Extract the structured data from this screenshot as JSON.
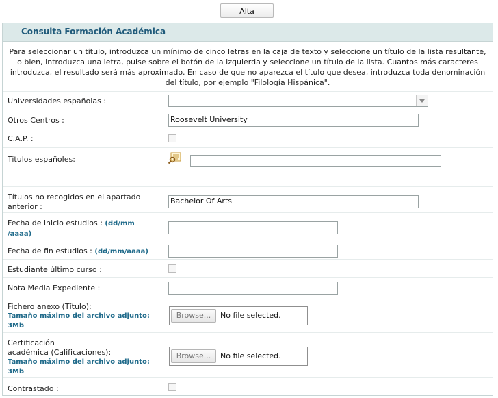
{
  "toolbar": {
    "alta_label": "Alta"
  },
  "panel": {
    "title": "Consulta Formación Académica",
    "intro": "Para seleccionar un título, introduzca un mínimo de cinco letras en la caja de texto y seleccione un título de la lista resultante, o bien, introduzca una letra, pulse sobre el botón de la izquierda y seleccione un título de la lista. Cuantos más caracteres introduzca, el resultado será más aproximado. En caso de que no aparezca el título que desea, introduzca toda denominación del título, por ejemplo \"Filología Hispánica\"."
  },
  "form": {
    "universidades": {
      "label": "Universidades españolas :",
      "value": ""
    },
    "otros_centros": {
      "label": "Otros Centros :",
      "value": "Roosevelt University"
    },
    "cap": {
      "label": "C.A.P. :",
      "checked": false
    },
    "titulos_espanoles": {
      "label": "Titulos españoles:",
      "value": ""
    },
    "titulos_no_recogidos": {
      "label_line1": "Títulos no recogidos en el apartado",
      "label_line2": "anterior :",
      "value": "Bachelor Of Arts"
    },
    "fecha_inicio": {
      "label": "Fecha de inicio estudios :",
      "hint": "(dd/mm",
      "hint2": "/aaaa)",
      "value": ""
    },
    "fecha_fin": {
      "label": "Fecha de fin estudios :",
      "hint": "(dd/mm/aaaa)",
      "value": ""
    },
    "ultimo_curso": {
      "label": "Estudiante último curso :",
      "checked": false
    },
    "nota_media": {
      "label": "Nota Media Expediente :",
      "value": ""
    },
    "fichero_titulo": {
      "label": "Fichero anexo (Título):",
      "hint": "Tamaño máximo del archivo adjunto:",
      "hint2": "3Mb",
      "browse_label": "Browse...",
      "status": "No file selected."
    },
    "certificacion": {
      "label_line1": "Certificación",
      "label_line2": "académica (Calificaciones):",
      "hint": "Tamaño máximo del archivo adjunto:",
      "hint2": "3Mb",
      "browse_label": "Browse...",
      "status": "No file selected."
    },
    "contrastado": {
      "label": "Contrastado :",
      "checked": false
    }
  },
  "icons": {
    "lookup": "search-list-icon"
  },
  "colors": {
    "header_bg": "#dce9e9",
    "title": "#1f5a7a",
    "hint": "#1f6a8a"
  }
}
